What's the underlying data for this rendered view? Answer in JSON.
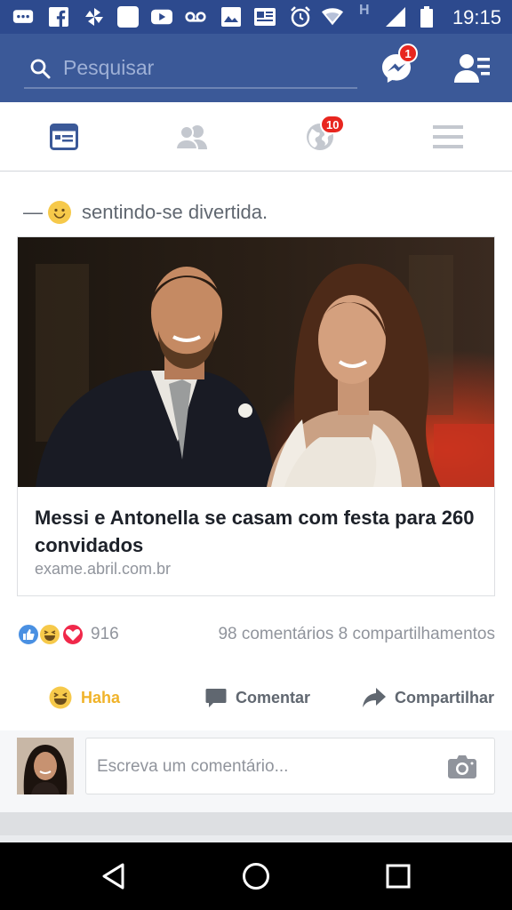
{
  "status_bar": {
    "time": "19:15",
    "network_label": "H",
    "icons": [
      "messenger-notif-icon",
      "facebook-notif-icon",
      "pinwheel-icon",
      "blank-notif-icon",
      "youtube-icon",
      "voicemail-icon",
      "gallery-icon",
      "news-icon",
      "alarm-icon",
      "wifi-icon",
      "signal-icon",
      "battery-icon"
    ]
  },
  "header": {
    "search_placeholder": "Pesquisar",
    "messenger_badge": "1",
    "background_color": "#3b5998"
  },
  "tabs": {
    "items": [
      {
        "name": "news-feed",
        "icon": "news-feed-icon",
        "active": true
      },
      {
        "name": "friend-requests",
        "icon": "friends-icon",
        "active": false
      },
      {
        "name": "notifications",
        "icon": "globe-icon",
        "badge": "10",
        "active": false
      },
      {
        "name": "menu",
        "icon": "hamburger-icon",
        "active": false
      }
    ],
    "notifications_badge": "10",
    "active_color": "#3b5998",
    "inactive_color": "#c4c8cf"
  },
  "post": {
    "feeling_dash": "—",
    "feeling_text": "sentindo-se divertida.",
    "link": {
      "title": "Messi e Antonella se casam com festa para 260 convidados",
      "domain": "exame.abril.com.br"
    },
    "reactions": {
      "types": [
        "like",
        "haha",
        "love"
      ],
      "count": "916",
      "comments": "98 comentários",
      "shares": "8 compartilhamentos"
    },
    "actions": {
      "reaction_label": "Haha",
      "comment_label": "Comentar",
      "share_label": "Compartilhar"
    },
    "comment_box": {
      "placeholder": "Escreva um comentário..."
    }
  },
  "colors": {
    "facebook_blue": "#3b5998",
    "like_blue": "#4a90e2",
    "haha_yellow": "#f6c94a",
    "love_red": "#f0284a",
    "badge_red": "#e8261f"
  }
}
